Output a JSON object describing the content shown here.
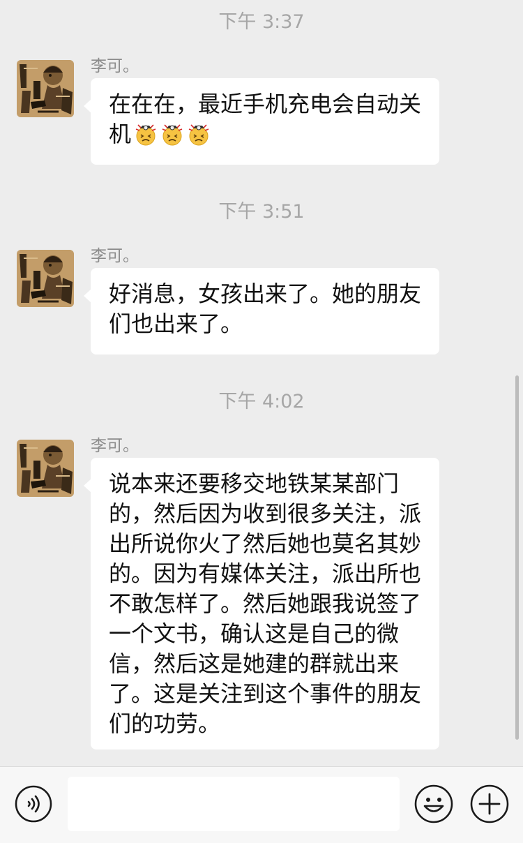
{
  "messages": [
    {
      "timestamp": "下午 3:37",
      "sender": "李可。",
      "text": "在在在，最近手机充电会自动关机",
      "emojis": [
        "tired-face-emoji",
        "tired-face-emoji",
        "tired-face-emoji"
      ]
    },
    {
      "timestamp": "下午 3:51",
      "sender": "李可。",
      "text": "好消息，女孩出来了。她的朋友们也出来了。"
    },
    {
      "timestamp": "下午 4:02",
      "sender": "李可。",
      "text": "说本来还要移交地铁某某部门的，然后因为收到很多关注，派出所说你火了然后她也莫名其妙的。因为有媒体关注，派出所也不敢怎样了。然后她跟我说签了一个文书，确认这是自己的微信，然后这是她建的群就出来了。这是关注到这个事件的朋友们的功劳。"
    }
  ],
  "input_bar": {
    "voice_icon": "voice-icon",
    "text_value": "",
    "emoji_icon": "smiley-icon",
    "more_icon": "plus-icon"
  },
  "colors": {
    "background": "#ededed",
    "bubble": "#ffffff",
    "timestamp": "#a6a6a6",
    "sender": "#8c8c8c"
  }
}
